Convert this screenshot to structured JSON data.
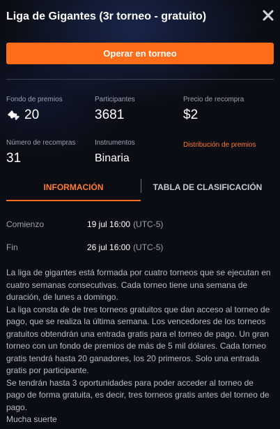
{
  "header": {
    "title": "Liga de Gigantes (3r torneo -  gratuito)",
    "close_icon": "close-icon"
  },
  "cta": {
    "label": "Operar en torneo"
  },
  "stats": {
    "prize_fund": {
      "label": "Fondo de premios",
      "value": "20",
      "icon": "tickets-icon"
    },
    "participants": {
      "label": "Participantes",
      "value": "3681"
    },
    "rebuy_price": {
      "label": "Precio de recompra",
      "value": "$2"
    },
    "rebuys": {
      "label": "Número de recompras",
      "value": "31"
    },
    "instruments": {
      "label": "Instrumentos",
      "value": "Binaria"
    },
    "prize_link": "Distribución de premios"
  },
  "tabs": {
    "info": "INFORMACIÓN",
    "leaderboard": "TABLA DE CLASIFICACIÓN"
  },
  "schedule": {
    "start_label": "Comienzo",
    "start_value": "19 jul 16:00",
    "start_tz": "(UTC-5)",
    "end_label": "Fin",
    "end_value": "26 jul 16:00",
    "end_tz": "(UTC-5)"
  },
  "description": [
    "La liga de gigantes está formada por cuatro torneos que se ejecutan en cuatro semanas consecutivas. Cada torneo tiene una semana de duración, de lunes a domingo.",
    "La liga consta de de tres torneos gratuitos que dan acceso al torneo de pago, que se realiza la última semana. Los vencedores de los torneos gratuitos obtendrán una entrada gratis para el torneo de pago. Un gran torneo con un fondo de premios de más de 5 mil dólares. Cada torneo gratis tendrá hasta 20 ganadores, los 20 primeros. Solo una entrada gratis por participante.",
    "Se tendrán hasta 3 oportunidades para poder acceder al torneo de pago de forma gratuita, es decir, tres torneos gratis antes del torneo de pago.",
    "Mucha suerte"
  ],
  "colors": {
    "accent": "#ff6d1b",
    "background": "#0b0d14",
    "muted_text": "#9aa0b2"
  }
}
